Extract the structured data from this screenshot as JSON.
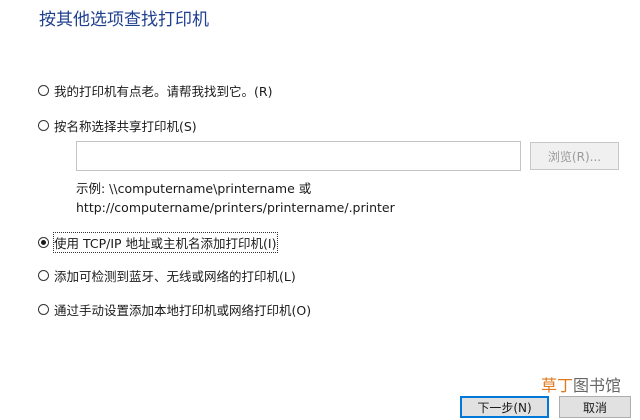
{
  "page_title": "按其他选项查找打印机",
  "options": [
    {
      "label": "我的打印机有点老。请帮我找到它。(R)",
      "checked": false
    },
    {
      "label": "按名称选择共享打印机(S)",
      "checked": false
    },
    {
      "label": "使用 TCP/IP 地址或主机名添加打印机(I)",
      "checked": true
    },
    {
      "label": "添加可检测到蓝牙、无线或网络的打印机(L)",
      "checked": false
    },
    {
      "label": "通过手动设置添加本地打印机或网络打印机(O)",
      "checked": false
    }
  ],
  "share_input": {
    "value": ""
  },
  "browse_label": "浏览(R)...",
  "example": {
    "line1": "示例: \\\\computername\\printername 或",
    "line2": "http://computername/printers/printername/.printer"
  },
  "watermark": {
    "part_a": "草丁",
    "part_b": "图书馆"
  },
  "buttons": {
    "next": "下一步(N)",
    "cancel": "取消"
  }
}
